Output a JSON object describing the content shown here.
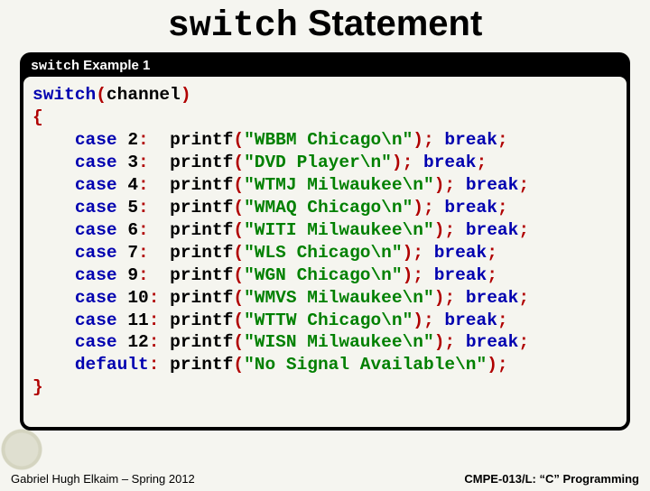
{
  "title_code": "switch",
  "title_rest": " Statement",
  "panel_title_code": "switch",
  "panel_title_rest": " Example 1",
  "code": {
    "head_kw": "switch",
    "head_paren_open": "(",
    "head_var": "channel",
    "head_paren_close": ")",
    "brace_open": "{",
    "cases": [
      {
        "num": "2",
        "str": "\"WBBM Chicago\\n\""
      },
      {
        "num": "3",
        "str": "\"DVD Player\\n\""
      },
      {
        "num": "4",
        "str": "\"WTMJ Milwaukee\\n\""
      },
      {
        "num": "5",
        "str": "\"WMAQ Chicago\\n\""
      },
      {
        "num": "6",
        "str": "\"WITI Milwaukee\\n\""
      },
      {
        "num": "7",
        "str": "\"WLS Chicago\\n\""
      },
      {
        "num": "9",
        "str": "\"WGN Chicago\\n\""
      },
      {
        "num": "10",
        "str": "\"WMVS Milwaukee\\n\""
      },
      {
        "num": "11",
        "str": "\"WTTW Chicago\\n\""
      },
      {
        "num": "12",
        "str": "\"WISN Milwaukee\\n\""
      }
    ],
    "default_str": "\"No Signal Available\\n\"",
    "brace_close": "}",
    "kw_case": "case",
    "kw_default": "default",
    "kw_break": "break",
    "fn_printf": "printf"
  },
  "footer_left": "Gabriel Hugh Elkaim – Spring 2012",
  "footer_right": "CMPE-013/L: “C” Programming"
}
